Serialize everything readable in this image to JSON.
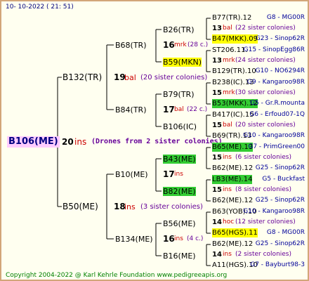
{
  "date": "10- 10-2022 ( 21: 51)",
  "root": "B106(ME)",
  "g1_num": "20",
  "g1_ins": "ins",
  "drones": "(Drones from 2 sister colonies)",
  "sire": {
    "name": "B132(TR)",
    "num": "19",
    "ins": "bal",
    "note": "(20 sister colonies)",
    "a": {
      "name": "B68(TR)",
      "a": {
        "name": "B26(TR)",
        "num": "16",
        "ins": "mrk",
        "note": "(28 c.)"
      },
      "b": {
        "name": "B59(MKN)"
      }
    },
    "b": {
      "name": "B84(TR)",
      "num": "17",
      "ins": "bal",
      "note": "(22 c.)",
      "a": {
        "name": "B79(TR)"
      },
      "b": {
        "name": "B106(IC)"
      }
    }
  },
  "dam": {
    "name": "B50(ME)",
    "num": "18",
    "ins": "ins",
    "note": "(3 sister colonies)",
    "a": {
      "name": "B10(ME)",
      "num": "17",
      "ins": "ins",
      "a": {
        "name": "B43(ME)"
      },
      "b": {
        "name": "B82(ME)"
      }
    },
    "b": {
      "name": "B134(ME)",
      "num": "16",
      "ins": "ins",
      "note": "(4 c.)",
      "a": {
        "name": "B56(ME)"
      },
      "b": {
        "name": "B16(ME)"
      }
    }
  },
  "g4": [
    {
      "name": "B77(TR).12",
      "src": "G8 - MG00R"
    },
    {
      "num": "13",
      "ins": "bal",
      "note": "(22 sister colonies)"
    },
    {
      "name": "B47(MKK).09",
      "src": "G23 - Sinop62R",
      "hl": "yellow"
    },
    {
      "name": "ST206.11.",
      "src": "G15 - SinopEgg86R"
    },
    {
      "num": "13",
      "ins": "mrk",
      "note": "(24 sister colonies)"
    },
    {
      "name": "B129(TR).10",
      "src": "G10 - NO6294R"
    },
    {
      "name": "B238(IC).13",
      "src": "G9 - Kangaroo98R"
    },
    {
      "num": "15",
      "ins": "mrk",
      "note": "(30 sister colonies)"
    },
    {
      "name": "B53(MKK).12",
      "src": "G5 - Gr.R.mounta",
      "hl": "green"
    },
    {
      "name": "B417(IC).15",
      "src": "G6 - Erfoud07-1Q"
    },
    {
      "num": "15",
      "ins": "bal",
      "note": "(20 sister colonies)"
    },
    {
      "name": "B69(TR).13",
      "src": "G10 - Kangaroo98R"
    },
    {
      "name": "B65(ME).13",
      "src": "G7 - PrimGreen00",
      "hl": "green"
    },
    {
      "num": "15",
      "ins": "ins",
      "note": "(6 sister colonies)"
    },
    {
      "name": "B62(ME).12",
      "src": "G25 - Sinop62R"
    },
    {
      "name": "LB3(ME).14",
      "src": "G5 - Buckfast",
      "hl": "green"
    },
    {
      "num": "15",
      "ins": "ins",
      "note": "(8 sister colonies)"
    },
    {
      "name": "B62(ME).12",
      "src": "G25 - Sinop62R"
    },
    {
      "name": "B63(YOB).10",
      "src": "G10 - Kangaroo98R"
    },
    {
      "num": "14",
      "ins": "hoc",
      "note": "(12 sister colonies)"
    },
    {
      "name": "B65(HGS).11",
      "src": "G8 - MG00R",
      "hl": "yellow"
    },
    {
      "name": "B62(ME).12",
      "src": "G25 - Sinop62R"
    },
    {
      "num": "14",
      "ins": "ins",
      "note": "(2 sister colonies)"
    },
    {
      "name": "A11(HGS).10",
      "src": "G7 - Bayburt98-3"
    }
  ],
  "footer": "Copyright 2004-2022 @ Karl Kehrle Foundation     www.pedigreeapis.org"
}
